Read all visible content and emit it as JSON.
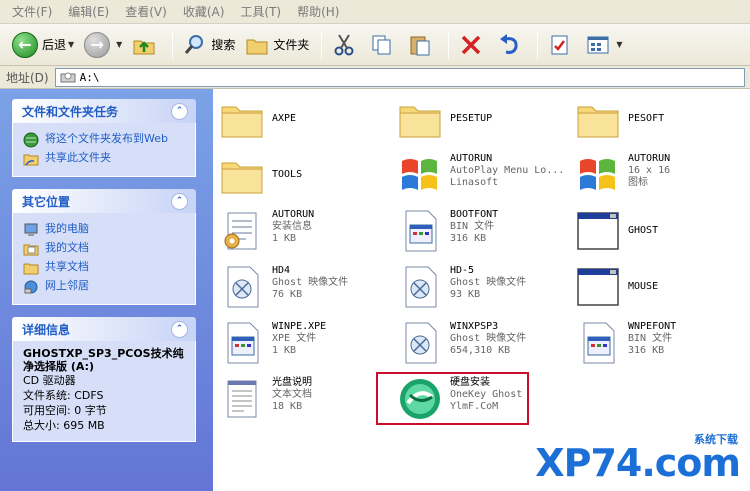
{
  "menu": [
    "文件(F)",
    "编辑(E)",
    "查看(V)",
    "收藏(A)",
    "工具(T)",
    "帮助(H)"
  ],
  "toolbar": {
    "back": "后退",
    "search": "搜索",
    "folders": "文件夹"
  },
  "address": {
    "label": "地址(D)",
    "path": "A:\\"
  },
  "tasks": {
    "title": "文件和文件夹任务",
    "items": [
      "将这个文件夹发布到Web",
      "共享此文件夹"
    ]
  },
  "places": {
    "title": "其它位置",
    "items": [
      "我的电脑",
      "我的文档",
      "共享文档",
      "网上邻居"
    ]
  },
  "details": {
    "title": "详细信息",
    "name": "GHOSTXP_SP3_PCOS技术纯净选择版 (A:)",
    "type": "CD 驱动器",
    "fs": "文件系统: CDFS",
    "free": "可用空间: 0 字节",
    "total": "总大小: 695 MB"
  },
  "files": [
    {
      "name": "AXPE",
      "l2": "",
      "l3": "",
      "icon": "folder-icon"
    },
    {
      "name": "PESETUP",
      "l2": "",
      "l3": "",
      "icon": "folder-icon"
    },
    {
      "name": "PESOFT",
      "l2": "",
      "l3": "",
      "icon": "folder-icon"
    },
    {
      "name": "TOOLS",
      "l2": "",
      "l3": "",
      "icon": "folder-icon"
    },
    {
      "name": "AUTORUN",
      "l2": "AutoPlay Menu Lo...",
      "l3": "Linasoft",
      "icon": "windows-logo-icon"
    },
    {
      "name": "AUTORUN",
      "l2": "16 x 16",
      "l3": "图标",
      "icon": "windows-logo-icon"
    },
    {
      "name": "AUTORUN",
      "l2": "安装信息",
      "l3": "1 KB",
      "icon": "notepad-gear-icon"
    },
    {
      "name": "BOOTFONT",
      "l2": "BIN 文件",
      "l3": "316 KB",
      "icon": "generic-file-icon"
    },
    {
      "name": "GHOST",
      "l2": "",
      "l3": "",
      "icon": "application-window-icon"
    },
    {
      "name": "HD4",
      "l2": "Ghost 映像文件",
      "l3": "76 KB",
      "icon": "ghost-image-icon"
    },
    {
      "name": "HD-5",
      "l2": "Ghost 映像文件",
      "l3": "93 KB",
      "icon": "ghost-image-icon"
    },
    {
      "name": "MOUSE",
      "l2": "",
      "l3": "",
      "icon": "application-window-icon"
    },
    {
      "name": "WINPE.XPE",
      "l2": "XPE 文件",
      "l3": "1 KB",
      "icon": "generic-file-icon"
    },
    {
      "name": "WINXPSP3",
      "l2": "Ghost 映像文件",
      "l3": "654,310 KB",
      "icon": "ghost-image-icon"
    },
    {
      "name": "WNPEFONT",
      "l2": "BIN 文件",
      "l3": "316 KB",
      "icon": "generic-file-icon"
    },
    {
      "name": "光盘说明",
      "l2": "文本文档",
      "l3": "18 KB",
      "icon": "text-document-icon"
    },
    {
      "name": "硬盘安装",
      "l2": "OneKey Ghost",
      "l3": "YlmF.CoM",
      "icon": "onekey-ghost-icon"
    }
  ],
  "watermark": {
    "main": "XP74.com",
    "sub": "系统下载"
  }
}
